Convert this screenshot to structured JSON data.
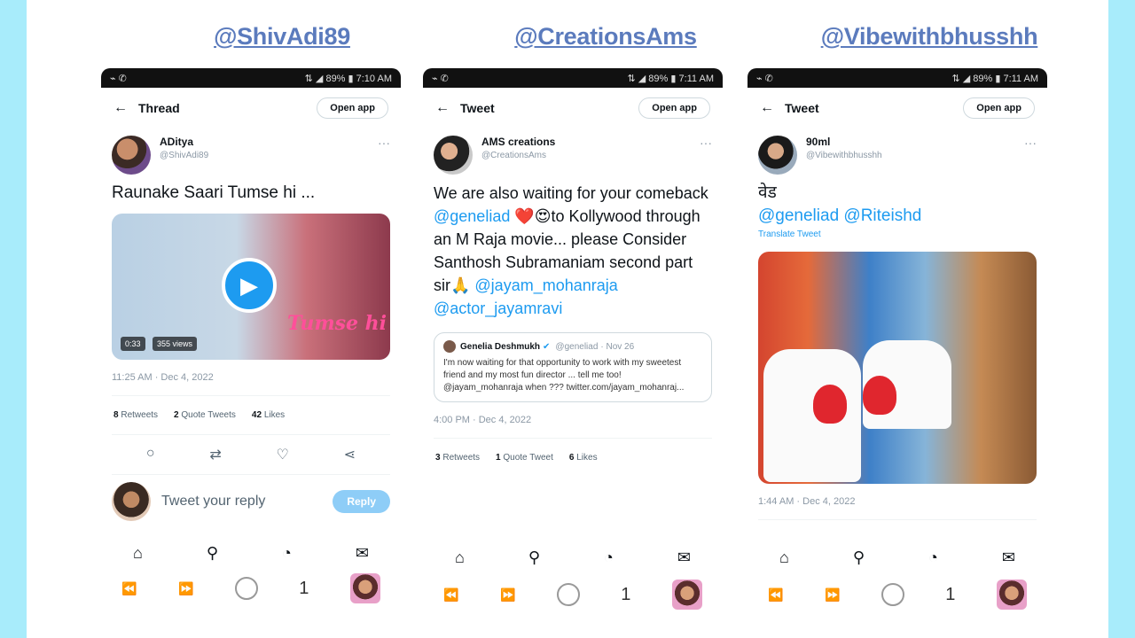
{
  "panels": [
    {
      "handle": "@ShivAdi89",
      "status": {
        "left": "⌁ ✆",
        "right": "⇅ ◢ 89% ▮ 7:10 AM"
      },
      "title": "Thread",
      "open_app": "Open app",
      "author_name": "ADitya",
      "author_handle": "@ShivAdi89",
      "text": "Raunake Saari Tumse hi ...",
      "media": {
        "duration": "0:33",
        "views": "355 views",
        "overlay": "Tumse hi"
      },
      "timestamp": "11:25 AM · Dec 4, 2022",
      "stats": {
        "retweets": "8",
        "retweets_label": "Retweets",
        "quotes": "2",
        "quotes_label": "Quote Tweets",
        "likes": "42",
        "likes_label": "Likes"
      },
      "reply_placeholder": "Tweet your reply",
      "reply_button": "Reply",
      "count": "1"
    },
    {
      "handle": "@CreationsAms",
      "status": {
        "left": "⌁ ✆",
        "right": "⇅ ◢ 89% ▮ 7:11 AM"
      },
      "title": "Tweet",
      "open_app": "Open app",
      "author_name": "AMS creations",
      "author_handle": "@CreationsAms",
      "text_pre": "We are also waiting for your comeback ",
      "mention1": "@geneliad",
      "text_mid": " ❤️😍to Kollywood through an M Raja movie... please Consider Santhosh Subramaniam second part sir🙏 ",
      "mention2": "@jayam_mohanraja",
      "mention3": "@actor_jayamravi",
      "quote": {
        "name": "Genelia Deshmukh",
        "handle": "@geneliad",
        "date": "· Nov 26",
        "text": "I'm now waiting for that opportunity to work with my sweetest friend and my most fun director ... tell me too! @jayam_mohanraja when ??? twitter.com/jayam_mohanraj..."
      },
      "timestamp": "4:00 PM · Dec 4, 2022",
      "stats": {
        "retweets": "3",
        "retweets_label": "Retweets",
        "quotes": "1",
        "quotes_label": "Quote Tweet",
        "likes": "6",
        "likes_label": "Likes"
      },
      "count": "1"
    },
    {
      "handle": "@Vibewithbhusshh",
      "status": {
        "left": "⌁ ✆",
        "right": "⇅ ◢ 89% ▮ 7:11 AM"
      },
      "title": "Tweet",
      "open_app": "Open app",
      "author_name": "90ml",
      "author_handle": "@Vibewithbhusshh",
      "text_line1": "वेड",
      "mention1": "@geneliad",
      "mention2": "@Riteishd",
      "translate": "Translate Tweet",
      "timestamp": "1:44 AM · Dec 4, 2022",
      "count": "1"
    }
  ],
  "icons": {
    "back": "←",
    "more": "···",
    "reply": "○",
    "retweet": "⇄",
    "like": "♡",
    "share": "⋖",
    "home": "⌂",
    "search": "⚲",
    "bell": "◔",
    "mail": "✉",
    "prev": "⏪",
    "next": "⏩",
    "play": "▶"
  }
}
